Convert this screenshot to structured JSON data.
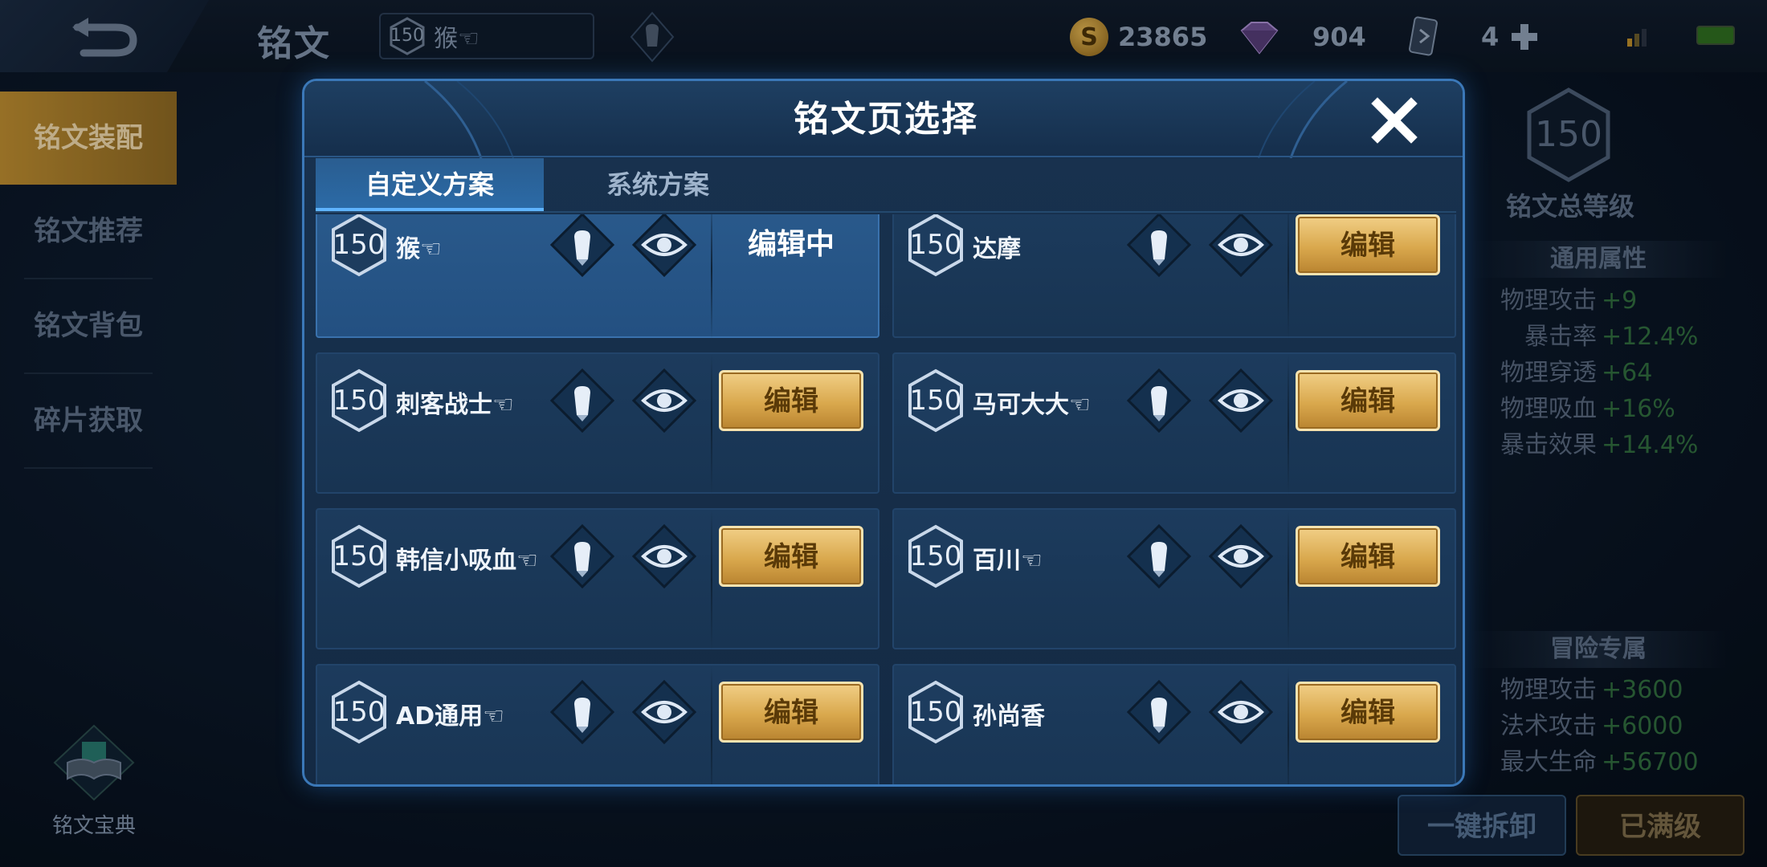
{
  "topbar": {
    "page_title": "铭文",
    "hero_level": "150",
    "hero_name": "猴☜",
    "gold": "23865",
    "diamonds": "904",
    "cards": "4"
  },
  "sidebar": {
    "items": [
      {
        "label": "铭文装配",
        "active": true
      },
      {
        "label": "铭文推荐",
        "active": false
      },
      {
        "label": "铭文背包",
        "active": false
      },
      {
        "label": "碎片获取",
        "active": false
      }
    ],
    "codex_label": "铭文宝典"
  },
  "right_panel": {
    "total_level": "150",
    "total_level_label": "铭文总等级",
    "general_title": "通用属性",
    "general_stats": [
      {
        "name": "物理攻击",
        "value": "+9"
      },
      {
        "name": "暴击率",
        "value": "+12.4%"
      },
      {
        "name": "物理穿透",
        "value": "+64"
      },
      {
        "name": "物理吸血",
        "value": "+16%"
      },
      {
        "name": "暴击效果",
        "value": "+14.4%"
      }
    ],
    "adventure_title": "冒险专属",
    "adventure_stats": [
      {
        "name": "物理攻击",
        "value": "+3600"
      },
      {
        "name": "法术攻击",
        "value": "+6000"
      },
      {
        "name": "最大生命",
        "value": "+56700"
      }
    ],
    "dismantle_label": "一键拆卸",
    "maxed_label": "已满级"
  },
  "modal": {
    "title": "铭文页选择",
    "tabs": [
      {
        "label": "自定义方案",
        "active": true
      },
      {
        "label": "系统方案",
        "active": false
      }
    ],
    "edit_label": "编辑",
    "editing_label": "编辑中",
    "pages": [
      {
        "level": "150",
        "name": "猴☜",
        "current": true
      },
      {
        "level": "150",
        "name": "达摩",
        "current": false
      },
      {
        "level": "150",
        "name": "刺客战士☜",
        "current": false
      },
      {
        "level": "150",
        "name": "马可大大☜",
        "current": false
      },
      {
        "level": "150",
        "name": "韩信小吸血☜",
        "current": false
      },
      {
        "level": "150",
        "name": "百川☜",
        "current": false
      },
      {
        "level": "150",
        "name": "AD通用☜",
        "current": false
      },
      {
        "level": "150",
        "name": "孙尚香",
        "current": false
      }
    ]
  },
  "colors": {
    "accent_blue": "#3b78b8",
    "gold_button": "#d9a84d",
    "stat_green": "#2f6a3c"
  }
}
